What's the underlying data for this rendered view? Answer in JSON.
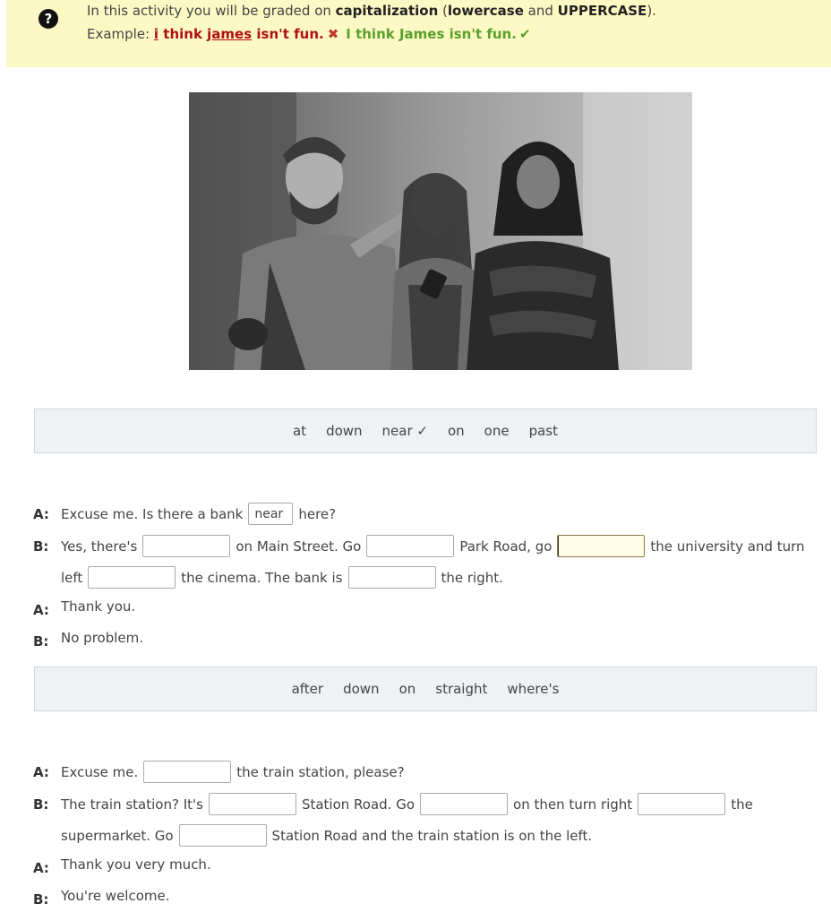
{
  "instructions": {
    "intro_prefix": "In this activity you will be graded on ",
    "capitalization": "capitalization",
    "paren_open": " (",
    "lowercase": "lowercase",
    "and": " and ",
    "uppercase": "UPPERCASE",
    "paren_close": ").",
    "example_label": "Example: ",
    "bad_i": "i",
    "bad_think": " think ",
    "bad_james": "james",
    "bad_rest": " isn't fun.",
    "good_example": "I think James isn't fun."
  },
  "photo": {
    "alt": "Three people looking at directions on a street"
  },
  "word_bank_1": [
    "at",
    "down",
    "near ✓",
    "on",
    "one",
    "past"
  ],
  "word_bank_2": [
    "after",
    "down",
    "on",
    "straight",
    "where's"
  ],
  "dialogue_1": {
    "a1_speaker": "A:",
    "a1_pre": "Excuse me. Is there a bank",
    "a1_gap": "near",
    "a1_post": "here?",
    "b1_speaker": "B:",
    "b1_t1": "Yes, there's",
    "b1_t2": "on Main Street. Go",
    "b1_t3": "Park Road, go",
    "b1_t4": "the university and turn",
    "b1_t5": "left",
    "b1_t6": "the cinema. The bank is",
    "b1_t7": "the right.",
    "a2_speaker": "A:",
    "a2_text": "Thank you.",
    "b2_speaker": "B:",
    "b2_text": "No problem."
  },
  "dialogue_2": {
    "a1_speaker": "A:",
    "a1_pre": "Excuse me.",
    "a1_post": "the train station, please?",
    "b1_speaker": "B:",
    "b1_t1": "The train station? It's",
    "b1_t2": "Station Road. Go",
    "b1_t3": "on then turn right",
    "b1_t4": "the",
    "b1_t5": "supermarket. Go",
    "b1_t6": "Station Road and the train station is on the left.",
    "a2_speaker": "A:",
    "a2_text": "Thank you very much.",
    "b2_speaker": "B:",
    "b2_text": "You're welcome."
  }
}
